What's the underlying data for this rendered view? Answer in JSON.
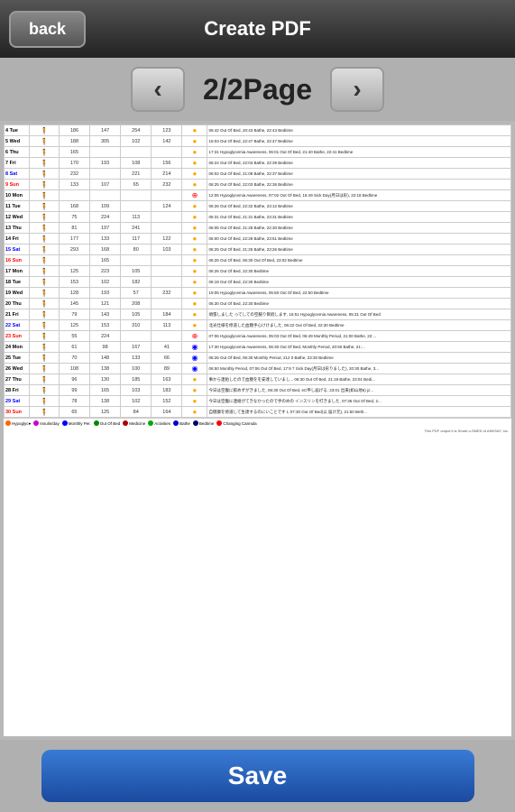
{
  "header": {
    "back_label": "back",
    "title": "Create PDF"
  },
  "nav": {
    "prev_label": "‹",
    "next_label": "›",
    "page_indicator": "2/2Page"
  },
  "save": {
    "label": "Save"
  },
  "legend": {
    "items": [
      {
        "label": "Hypoglyc●",
        "color": "#ff6600"
      },
      {
        "label": "Insulin/day",
        "color": "#cc00cc"
      },
      {
        "label": "Monthly Per.",
        "color": "#0000ff"
      },
      {
        "label": "Out Of Bed",
        "color": "#008800"
      },
      {
        "label": "Medicine",
        "color": "#aa0000"
      },
      {
        "label": "Activities",
        "color": "#00aa00"
      },
      {
        "label": "Bathe",
        "color": "#0000cc"
      },
      {
        "label": "Bedtime",
        "color": "#000066"
      },
      {
        "label": "Changing Cannula",
        "color": "#ff0000"
      }
    ]
  },
  "footer_text": "This PDF output it is Smart o-SMED of ANKSAY, Inc.",
  "rows": [
    {
      "day": "4 Tue",
      "type": "normal",
      "nums": [
        "186",
        "147",
        "254",
        "123"
      ],
      "notes": "05:42 Out Of Bed, 20:43 Bathe, 22:43 Bedtime"
    },
    {
      "day": "5 Wed",
      "type": "normal",
      "nums": [
        "188",
        "305",
        "102",
        "142"
      ],
      "notes": "15:03 Out Of Bed, 22:47 Bathe, 22:47 Bedtime"
    },
    {
      "day": "6 Thu",
      "type": "normal",
      "nums": [
        "165",
        "",
        "",
        ""
      ],
      "notes": "17:31 Hypoglycemia Awareness, 06:01 Out Of Bed, 21:40 Bathe, 22:41 Bedtime"
    },
    {
      "day": "7 Fri",
      "type": "normal",
      "nums": [
        "170",
        "193",
        "108",
        "156"
      ],
      "notes": "06:24 Out Of Bed, 22:03 Bathe, 22:39 Bedtime"
    },
    {
      "day": "8 Sat",
      "type": "sat",
      "nums": [
        "232",
        "",
        "221",
        "214"
      ],
      "notes": "06:02 Out Of Bed, 21:08 Bathe, 22:37 Bedtime"
    },
    {
      "day": "9 Sun",
      "type": "sun",
      "nums": [
        "133",
        "107",
        "65",
        "232"
      ],
      "notes": "06:25 Out Of Bed, 22:03 Bathe, 22:36 Bedtime"
    },
    {
      "day": "10 Mon",
      "type": "special",
      "nums": [
        "",
        "",
        "",
        ""
      ],
      "notes": "12:05 Hypoglycemia Awareness, 07:02 Out Of Bed, 16:49 Sick Day(月日は形), 22:18 Bedtime"
    },
    {
      "day": "11 Tue",
      "type": "normal",
      "nums": [
        "168",
        "109",
        "",
        "124"
      ],
      "notes": "06:26 Out Of Bed, 22:32 Bathe, 23:12 Bedtime"
    },
    {
      "day": "12 Wed",
      "type": "normal",
      "nums": [
        "75",
        "224",
        "113",
        ""
      ],
      "notes": "05:31 Out Of Bed, 21:31 Bathe, 23:31 Bedtime"
    },
    {
      "day": "13 Thu",
      "type": "normal",
      "nums": [
        "81",
        "197",
        "241",
        ""
      ],
      "notes": "06:05 Out Of Bed, 21:28 Bathe, 22:30 Bedtime"
    },
    {
      "day": "14 Fri",
      "type": "normal",
      "nums": [
        "177",
        "133",
        "117",
        "122"
      ],
      "notes": "06:00 Out Of Bed, 22:28 Bathe, 23:51 Bedtime"
    },
    {
      "day": "15 Sat",
      "type": "sat",
      "nums": [
        "293",
        "168",
        "80",
        "103"
      ],
      "notes": "06:25 Out Of Bed, 21:25 Bathe, 23:26 Bedtime"
    },
    {
      "day": "16 Sun",
      "type": "sun",
      "nums": [
        "",
        "165",
        "",
        ""
      ],
      "notes": "06:26 Out Of Bed, 06:30 Out Of Bed, 23:02 Bedtime"
    },
    {
      "day": "17 Mon",
      "type": "normal",
      "nums": [
        "125",
        "223",
        "105",
        ""
      ],
      "notes": "06:26 Out Of Bed, 22:30 Bedtime"
    },
    {
      "day": "18 Tue",
      "type": "normal",
      "nums": [
        "153",
        "102",
        "182",
        ""
      ],
      "notes": "06:19 Out Of Bed, 22:30 Bedtime"
    },
    {
      "day": "19 Wed",
      "type": "normal",
      "nums": [
        "128",
        "193",
        "57",
        "232"
      ],
      "notes": "19:05 Hypoglycemia Awareness, 05:50 Out Of Bed, 22:50 Bedtime"
    },
    {
      "day": "20 Thu",
      "type": "normal",
      "nums": [
        "145",
        "121",
        "208",
        ""
      ],
      "notes": "06:30 Out Of Bed, 22:30 Bedtime"
    },
    {
      "day": "21 Fri",
      "type": "normal",
      "nums": [
        "79",
        "143",
        "105",
        "184"
      ],
      "notes": "頑張しました ってしての空腸り目続します, 16:51 Hypoglycemia Awareness, 05:31 Out Of Bed"
    },
    {
      "day": "22 Sat",
      "type": "sat",
      "nums": [
        "125",
        "153",
        "310",
        "113"
      ],
      "notes": "北光仕様を修道した血糖手心けけました, 06:22 Out Of Bed, 22:30 Bedtime"
    },
    {
      "day": "23 Sun",
      "type": "sun_special",
      "nums": [
        "55",
        "224",
        "",
        ""
      ],
      "notes": "07:06 Hypoglycemia Awareness, 05:03 Out Of Bed, 06:49 Monthly Period, 21:00 Bathe, 22:..."
    },
    {
      "day": "24 Mon",
      "type": "special2",
      "nums": [
        "61",
        "98",
        "167",
        "41"
      ],
      "notes": "17:30 Hypoglycemia Awareness, 06:30 Out Of Bed, Monthly Period, 20:50 Bathe, 21:..."
    },
    {
      "day": "25 Tue",
      "type": "special2",
      "nums": [
        "70",
        "148",
        "133",
        "66"
      ],
      "notes": "06:26 Out Of Bed, 06:30 Monthly Period, 212 0 Bathe, 23:30 Bedtime"
    },
    {
      "day": "26 Wed",
      "type": "special2",
      "nums": [
        "108",
        "138",
        "100",
        "89"
      ],
      "notes": "06:50 Monthly Period, 07:06 Out Of Bed, 17:9 7 Sick Day(月日は形りました), 20:30 Bathe, 3..."
    },
    {
      "day": "27 Thu",
      "type": "normal",
      "nums": [
        "96",
        "130",
        "185",
        "163"
      ],
      "notes": "事から連粕したので血糖をを安達していまし...  06:30 Out Of Bed, 21:19 Bathe, 23:01 Bedi..."
    },
    {
      "day": "28 Fri",
      "type": "normal",
      "nums": [
        "99",
        "165",
        "103",
        "183"
      ],
      "notes": "今日は空腹に飲めずがきました, 06:30 Out Of Bed, eC申し届げる, 23:01 出来(如山地5) jz..."
    },
    {
      "day": "29 Sat",
      "type": "sat",
      "nums": [
        "78",
        "138",
        "102",
        "152"
      ],
      "notes": "今日は空腹に連絡がてきなかったので手のめの インスリンを打きました, 07:36 Out Of Bed, 2..."
    },
    {
      "day": "30 Sun",
      "type": "sun",
      "nums": [
        "65",
        "125",
        "84",
        "164"
      ],
      "notes": "自健康を修道して生達するのにいことです t, 07:30 Out Of Bed(以 届け元), 21:50 Beth..."
    }
  ]
}
